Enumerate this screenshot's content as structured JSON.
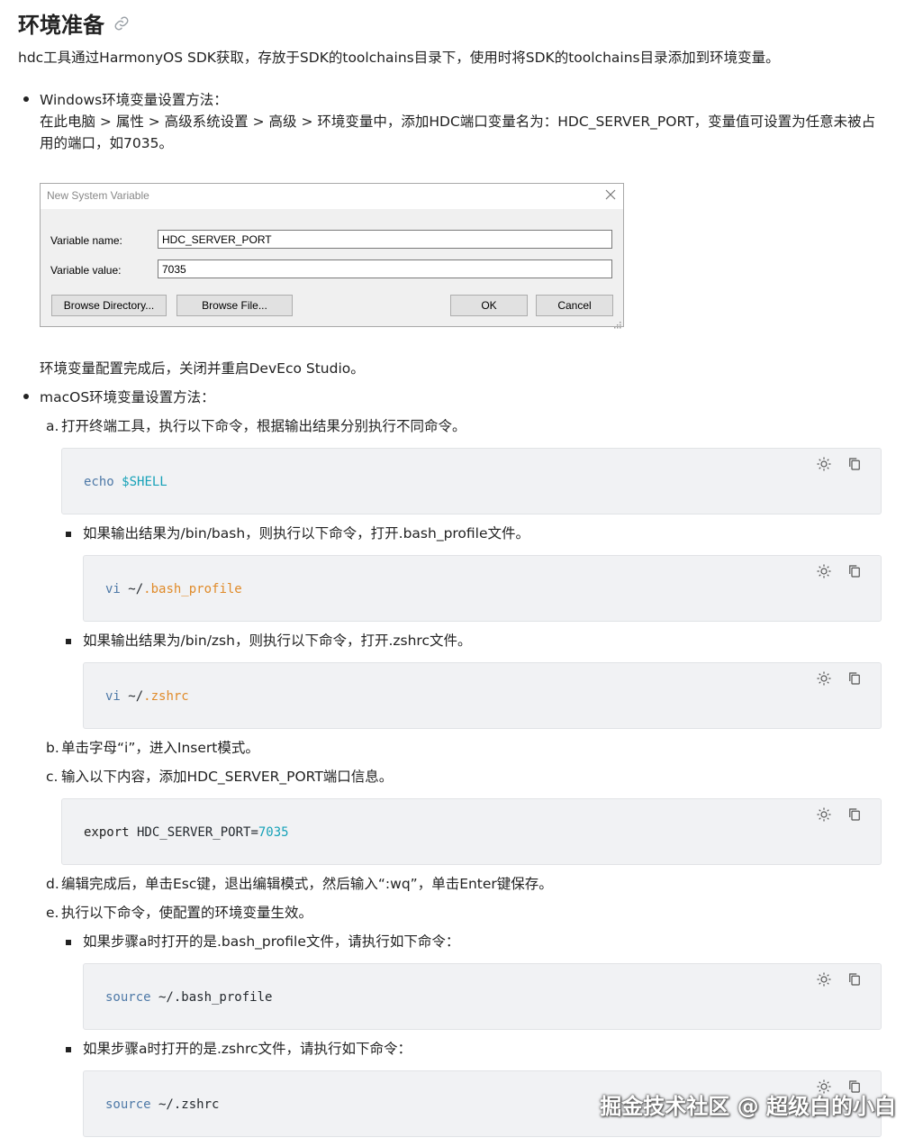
{
  "heading": "环境准备",
  "intro": "hdc工具通过HarmonyOS SDK获取，存放于SDK的toolchains目录下，使用时将SDK的toolchains目录添加到环境变量。",
  "windows": {
    "title": "Windows环境变量设置方法：",
    "line1": "在此电脑 > 属性 > 高级系统设置 > 高级 > 环境变量中，添加HDC端口变量名为：HDC_SERVER_PORT，变量值可设置为任意未被占",
    "line2": "用的端口，如7035。",
    "after": "环境变量配置完成后，关闭并重启DevEco Studio。"
  },
  "dialog": {
    "title": "New System Variable",
    "name_label": "Variable name:",
    "name_value": "HDC_SERVER_PORT",
    "value_label": "Variable value:",
    "value_value": "7035",
    "browse_dir": "Browse Directory...",
    "browse_file": "Browse File...",
    "ok": "OK",
    "cancel": "Cancel"
  },
  "mac": {
    "title": "macOS环境变量设置方法：",
    "step_a_mark": "a.",
    "step_a": "打开终端工具，执行以下命令，根据输出结果分别执行不同命令。",
    "code1": {
      "cmd": "echo",
      "arg": "$SHELL"
    },
    "sub1": "如果输出结果为/bin/bash，则执行以下命令，打开.bash_profile文件。",
    "code2": {
      "cmd": "vi",
      "pre": " ~/",
      "arg": ".bash_profile"
    },
    "sub2": "如果输出结果为/bin/zsh，则执行以下命令，打开.zshrc文件。",
    "code3": {
      "cmd": "vi",
      "pre": " ~/",
      "arg": ".zshrc"
    },
    "step_b_mark": "b.",
    "step_b": "单击字母“i”，进入Insert模式。",
    "step_c_mark": "c.",
    "step_c": "输入以下内容，添加HDC_SERVER_PORT端口信息。",
    "code4": {
      "cmd": "export",
      "pre": " HDC_SERVER_PORT=",
      "arg": "7035"
    },
    "step_d_mark": "d.",
    "step_d": "编辑完成后，单击Esc键，退出编辑模式，然后输入“:wq”，单击Enter键保存。",
    "step_e_mark": "e.",
    "step_e": "执行以下命令，使配置的环境变量生效。",
    "sub3": "如果步骤a时打开的是.bash_profile文件，请执行如下命令：",
    "code5": {
      "cmd": "source",
      "arg": " ~/.bash_profile"
    },
    "sub4": "如果步骤a时打开的是.zshrc文件，请执行如下命令：",
    "code6": {
      "cmd": "source",
      "arg": " ~/.zshrc"
    }
  },
  "watermark": "掘金技术社区 @ 超级白的小白",
  "icons": {
    "link": "link-icon",
    "theme": "sun-icon",
    "copy": "copy-icon"
  }
}
